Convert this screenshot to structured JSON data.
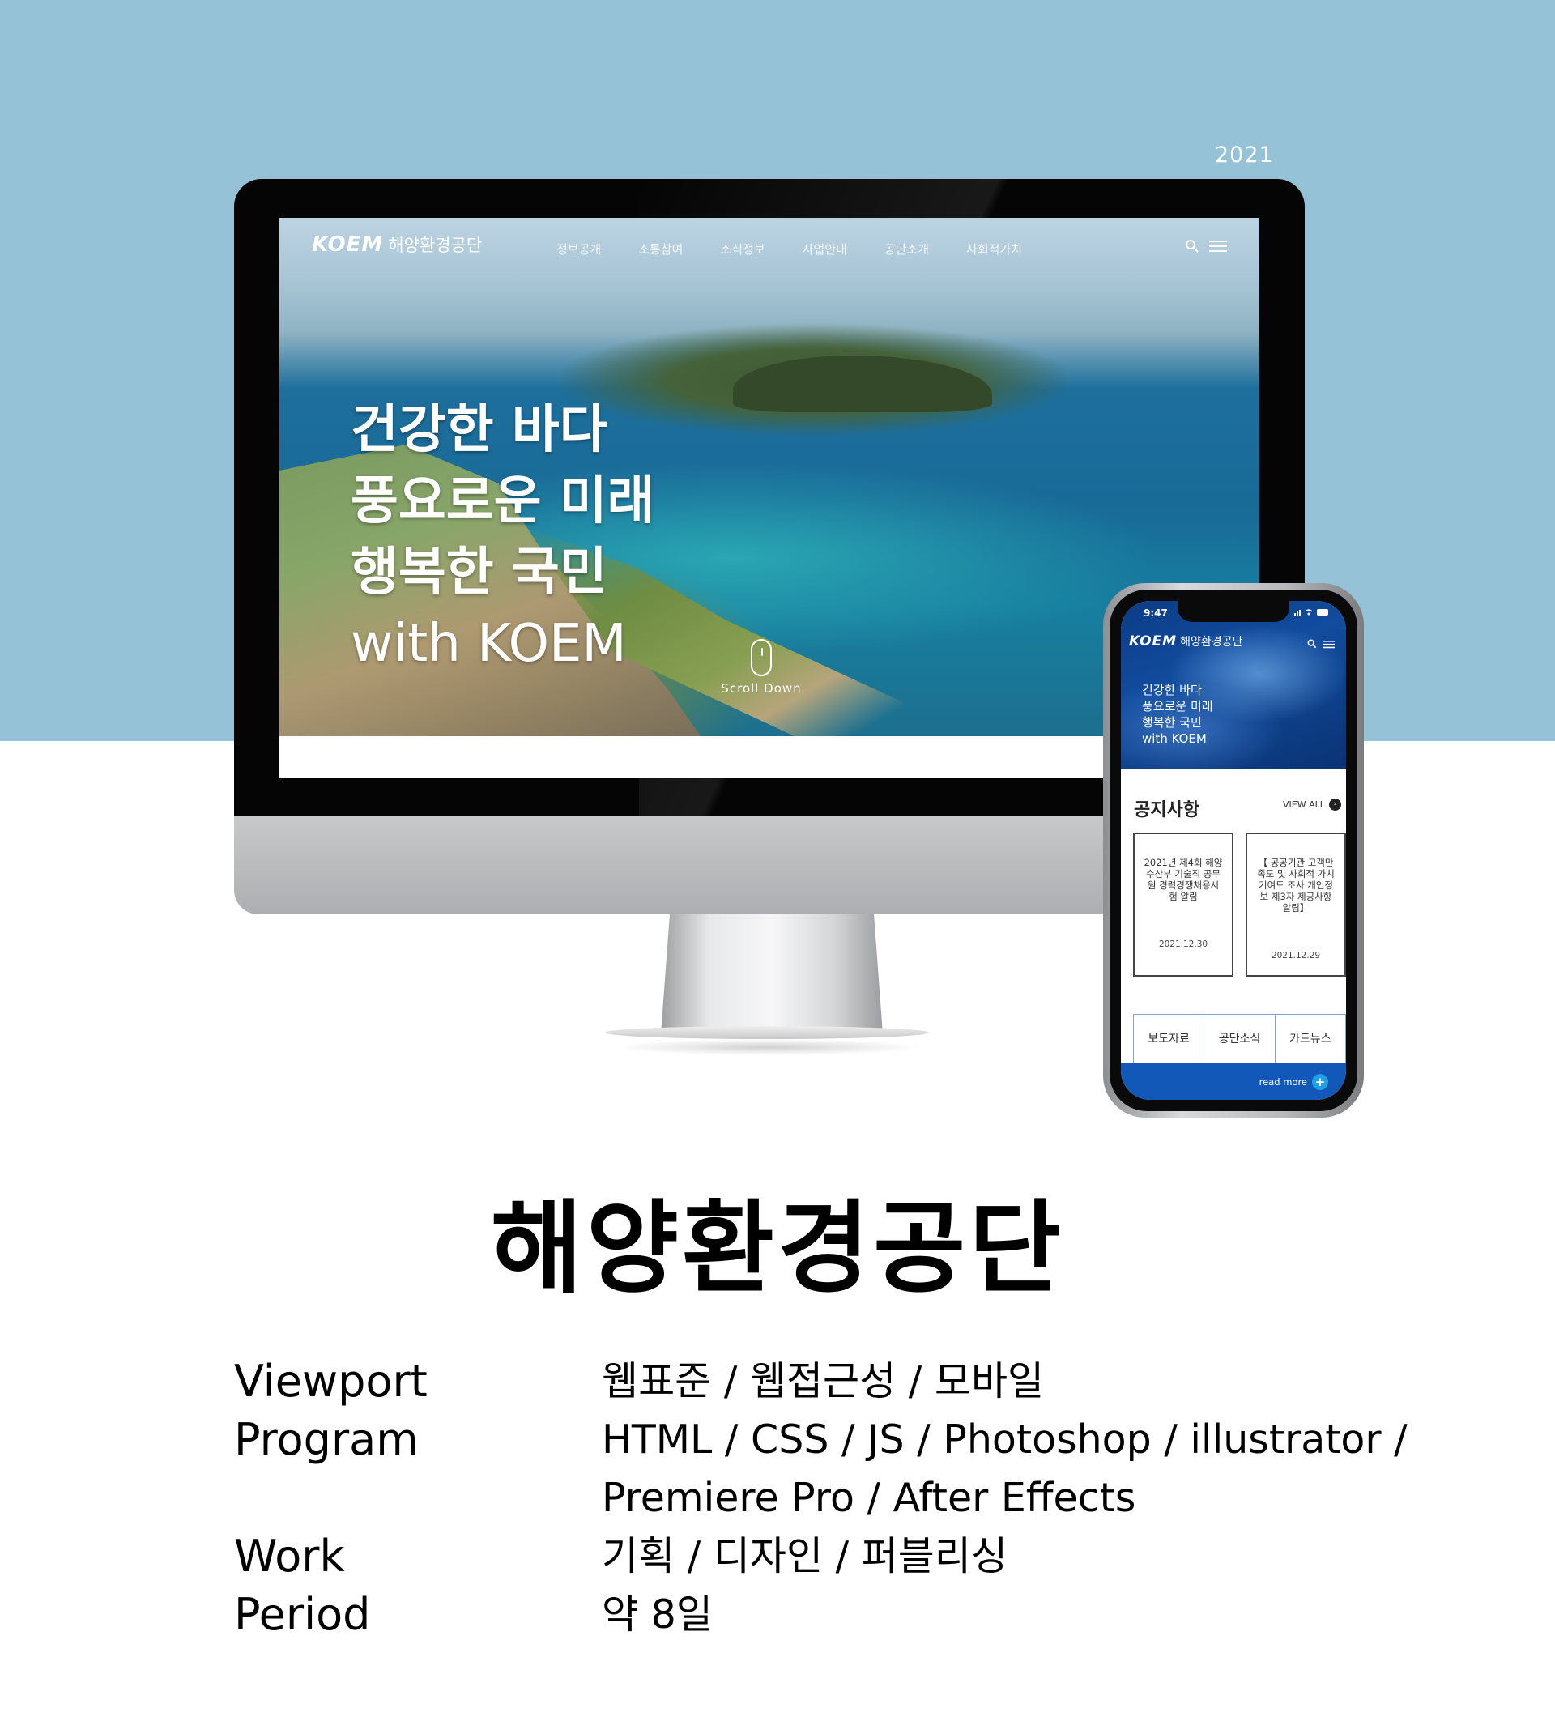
{
  "header": {
    "year": "2021"
  },
  "desktop": {
    "logo_mark": "KOEM",
    "logo_name": "해양환경공단",
    "nav": [
      "정보공개",
      "소통참여",
      "소식정보",
      "사업안내",
      "공단소개",
      "사회적가치"
    ],
    "hero_lines": [
      "건강한 바다",
      "풍요로운 미래",
      "행복한 국민",
      "with KOEM"
    ],
    "scroll_label": "Scroll Down",
    "icons": [
      "search-icon",
      "hamburger-icon"
    ]
  },
  "mobile": {
    "status_time": "9:47",
    "logo_mark": "KOEM",
    "logo_name": "해양환경공단",
    "hero_lines": [
      "건강한 바다",
      "풍요로운 미래",
      "행복한 국민",
      "with KOEM"
    ],
    "notice_title": "공지사항",
    "view_all": "VIEW ALL",
    "notices": [
      {
        "lines": [
          "2021년 제4회 해양",
          "수산부 기술직 공무",
          "원 경력경쟁채용시",
          "험 알림"
        ],
        "date": "2021.12.30"
      },
      {
        "lines": [
          "【 공공기관 고객만",
          "족도 및 사회적 가치",
          "기여도 조사 개인정",
          "보 제3자 제공사항",
          "알림】"
        ],
        "date": "2021.12.29"
      }
    ],
    "tabs": [
      "보도자료",
      "공단소식",
      "카드뉴스"
    ],
    "read_more": "read more"
  },
  "project": {
    "title": "해양환경공단",
    "details": [
      {
        "label": "Viewport",
        "value": "웹표준 / 웹접근성 / 모바일"
      },
      {
        "label": "Program",
        "value": "HTML / CSS / JS / Photoshop / illustrator /"
      },
      {
        "label": "",
        "value": "Premiere Pro / After Effects"
      },
      {
        "label": "Work",
        "value": "기획 / 디자인 / 퍼블리싱"
      },
      {
        "label": "Period",
        "value": "약 8일"
      }
    ]
  },
  "colors": {
    "band": "#95c2d6",
    "mobile_accent": "#1258b8",
    "plus_dot": "#1fa0e8"
  }
}
